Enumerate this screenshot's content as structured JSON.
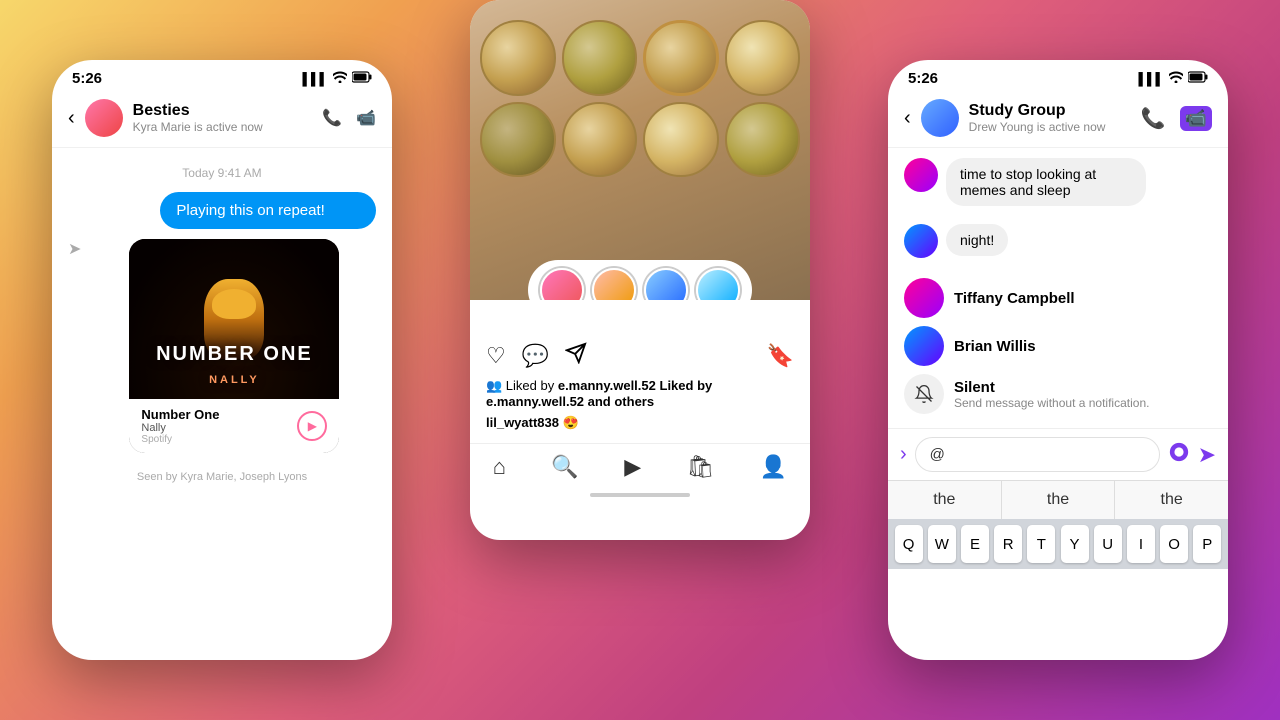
{
  "background": {
    "gradient": "linear-gradient(135deg, #f7d76b 0%, #f0a050 20%, #e0607a 50%, #c04080 70%, #a030c0 100%)"
  },
  "left_phone": {
    "status_bar": {
      "time": "5:26",
      "signal": "▌▌▌",
      "wifi": "wifi",
      "battery": "battery"
    },
    "header": {
      "back": "‹",
      "name": "Besties",
      "status": "Kyra Marie is active now",
      "phone_icon": "📞",
      "video_icon": "📹"
    },
    "chat": {
      "date_label": "Today 9:41 AM",
      "bubble_out": "Playing this on repeat!",
      "music_card": {
        "title": "Number One",
        "artist": "Nally",
        "source": "Spotify"
      },
      "seen_by": "Seen by Kyra Marie, Joseph Lyons"
    }
  },
  "center_phone": {
    "liked_by": "Liked by e.manny.well.52 and others",
    "caption_user": "lil_wyatt838",
    "caption_emoji": "😍",
    "nav_items": [
      "home",
      "search",
      "reels",
      "shop",
      "profile"
    ]
  },
  "right_phone": {
    "status_bar": {
      "time": "5:26"
    },
    "header": {
      "name": "Study Group",
      "status": "Drew Young is active now"
    },
    "messages": [
      {
        "text": "time to stop looking at memes and sleep",
        "type": "in"
      },
      {
        "text": "night!",
        "type": "in"
      }
    ],
    "contacts": [
      {
        "name": "Tiffany Campbell"
      },
      {
        "name": "Brian Willis"
      }
    ],
    "silent": {
      "title": "Silent",
      "description": "Send message without a notification."
    },
    "input": {
      "placeholder": "@",
      "value": "@"
    },
    "suggestions": [
      "the",
      "the",
      "the"
    ],
    "keyboard_row": [
      "Q",
      "W",
      "E",
      "R",
      "T",
      "Y",
      "U",
      "I",
      "O",
      "P"
    ]
  }
}
